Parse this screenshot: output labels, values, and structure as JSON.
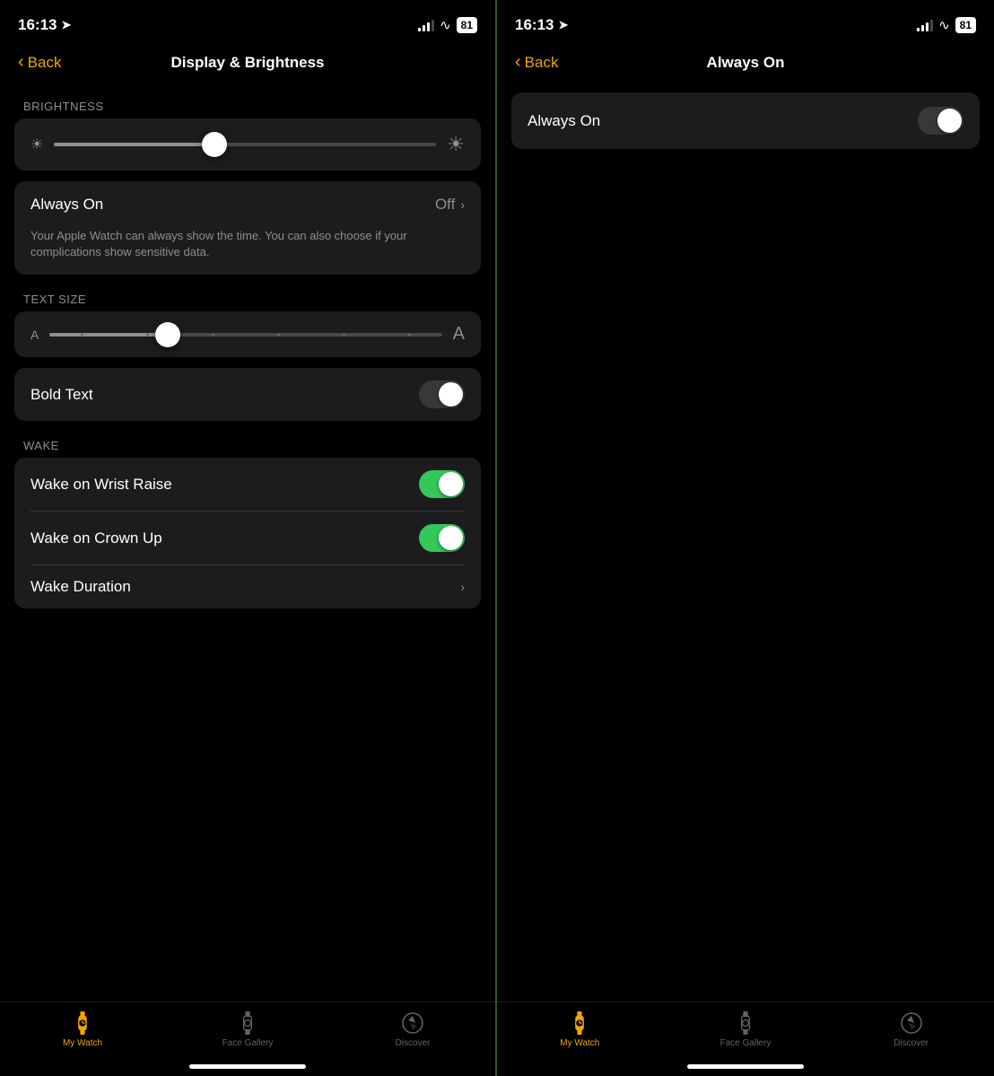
{
  "left_screen": {
    "status": {
      "time": "16:13",
      "battery": "81"
    },
    "nav": {
      "back_label": "Back",
      "title": "Display & Brightness"
    },
    "brightness": {
      "section_label": "BRIGHTNESS",
      "thumb_position_pct": 42
    },
    "always_on": {
      "label": "Always On",
      "value": "Off"
    },
    "description": "Your Apple Watch can always show the time. You can also choose if your complications show sensitive data.",
    "text_size": {
      "section_label": "TEXT SIZE"
    },
    "bold_text": {
      "label": "Bold Text",
      "enabled": false
    },
    "wake": {
      "section_label": "WAKE",
      "items": [
        {
          "label": "Wake on Wrist Raise",
          "type": "toggle",
          "enabled": true
        },
        {
          "label": "Wake on Crown Up",
          "type": "toggle",
          "enabled": true
        },
        {
          "label": "Wake Duration",
          "type": "link"
        }
      ]
    },
    "tabs": [
      {
        "label": "My Watch",
        "active": true,
        "icon": "watch"
      },
      {
        "label": "Face Gallery",
        "active": false,
        "icon": "gallery"
      },
      {
        "label": "Discover",
        "active": false,
        "icon": "compass"
      }
    ]
  },
  "right_screen": {
    "status": {
      "time": "16:13",
      "battery": "81"
    },
    "nav": {
      "back_label": "Back",
      "title": "Always On"
    },
    "always_on": {
      "label": "Always On",
      "enabled": false
    },
    "tabs": [
      {
        "label": "My Watch",
        "active": true,
        "icon": "watch"
      },
      {
        "label": "Face Gallery",
        "active": false,
        "icon": "gallery"
      },
      {
        "label": "Discover",
        "active": false,
        "icon": "compass"
      }
    ]
  }
}
